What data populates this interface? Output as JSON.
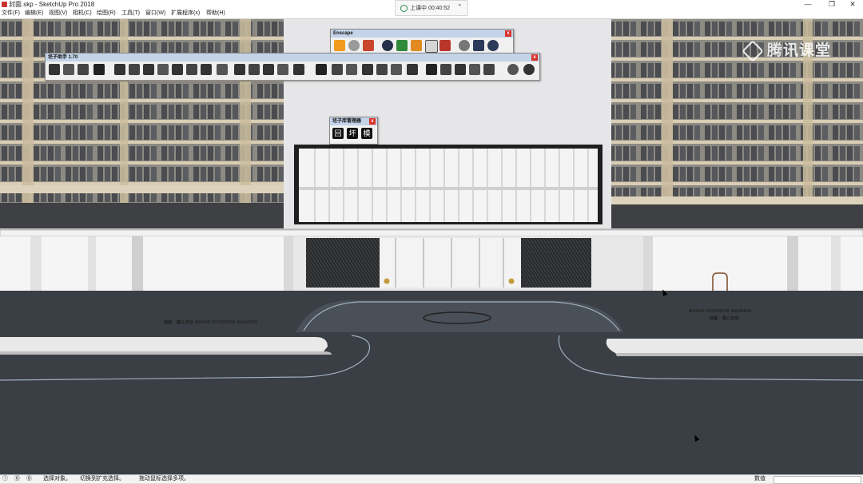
{
  "window": {
    "title": "封面.skp - SketchUp Pro 2018",
    "minimize": "—",
    "restore": "❐",
    "close": "✕"
  },
  "menu": [
    "文件(F)",
    "编辑(E)",
    "视图(V)",
    "相机(C)",
    "绘图(R)",
    "工具(T)",
    "窗口(W)",
    "扩展程序(x)",
    "帮助(H)"
  ],
  "live": {
    "label": "上课中 00:40:52"
  },
  "watermark": "腾讯课堂",
  "toolbars": {
    "escape": {
      "title": "Enscape"
    },
    "helper": {
      "title": "坯子助手 1.70"
    },
    "library": {
      "title": "坯子库管理器",
      "buttons": [
        "回",
        "坏",
        "模"
      ]
    }
  },
  "signs": {
    "left": "御園 · 臨江府邸    MANHE RIVERSIDE MANSION",
    "right_en": "MANHE RIVERSIDE MANSION",
    "right_cn": "御園 · 臨江府邸"
  },
  "statusbar": {
    "hint1": "选择对象。",
    "hint2": "切换到扩充选择。",
    "hint3": "拖动鼠标选择多项。",
    "measure_label": "数值"
  },
  "colors": {
    "accent": "#d9322a",
    "road": "#3a3f45",
    "titlebar_blue": "#c3d3e8"
  }
}
